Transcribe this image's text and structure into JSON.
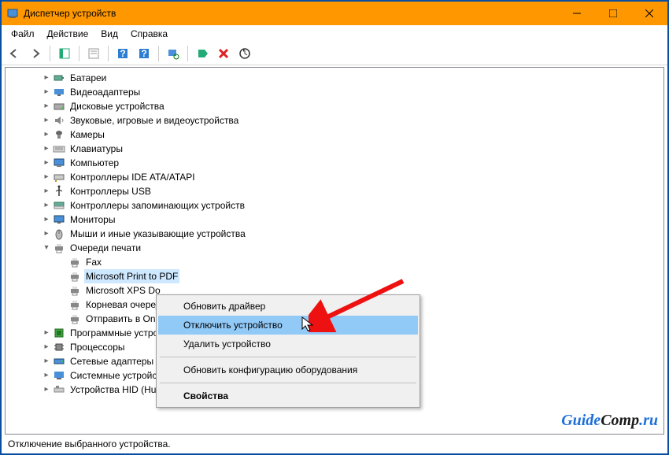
{
  "title": "Диспетчер устройств",
  "menu": {
    "file": "Файл",
    "action": "Действие",
    "view": "Вид",
    "help": "Справка"
  },
  "tree": {
    "items": [
      {
        "icon": "battery",
        "label": "Батареи"
      },
      {
        "icon": "display",
        "label": "Видеоадаптеры"
      },
      {
        "icon": "disk",
        "label": "Дисковые устройства"
      },
      {
        "icon": "sound",
        "label": "Звуковые, игровые и видеоустройства"
      },
      {
        "icon": "camera",
        "label": "Камеры"
      },
      {
        "icon": "keyboard",
        "label": "Клавиатуры"
      },
      {
        "icon": "computer",
        "label": "Компьютер"
      },
      {
        "icon": "ide",
        "label": "Контроллеры IDE ATA/ATAPI"
      },
      {
        "icon": "usb",
        "label": "Контроллеры USB"
      },
      {
        "icon": "storage",
        "label": "Контроллеры запоминающих устройств"
      },
      {
        "icon": "monitor",
        "label": "Мониторы"
      },
      {
        "icon": "mouse",
        "label": "Мыши и иные указывающие устройства"
      }
    ],
    "printqueue": {
      "label": "Очереди печати",
      "children": [
        {
          "label": "Fax"
        },
        {
          "label": "Microsoft Print to PDF",
          "selected": true
        },
        {
          "label": "Microsoft XPS Do"
        },
        {
          "label": "Корневая очеред"
        },
        {
          "label": "Отправить в One"
        }
      ]
    },
    "after": [
      {
        "icon": "firmware",
        "label": "Программные устро"
      },
      {
        "icon": "cpu",
        "label": "Процессоры"
      },
      {
        "icon": "network",
        "label": "Сетевые адаптеры"
      },
      {
        "icon": "system",
        "label": "Системные устройст"
      },
      {
        "icon": "hid",
        "label": "Устройства HID (Human Interface Devices)"
      }
    ]
  },
  "context": {
    "update": "Обновить драйвер",
    "disable": "Отключить устройство",
    "uninstall": "Удалить устройство",
    "scan": "Обновить конфигурацию оборудования",
    "props": "Свойства"
  },
  "status": "Отключение выбранного устройства.",
  "watermark": {
    "a": "Guide",
    "b": "Comp",
    "c": ".ru"
  }
}
